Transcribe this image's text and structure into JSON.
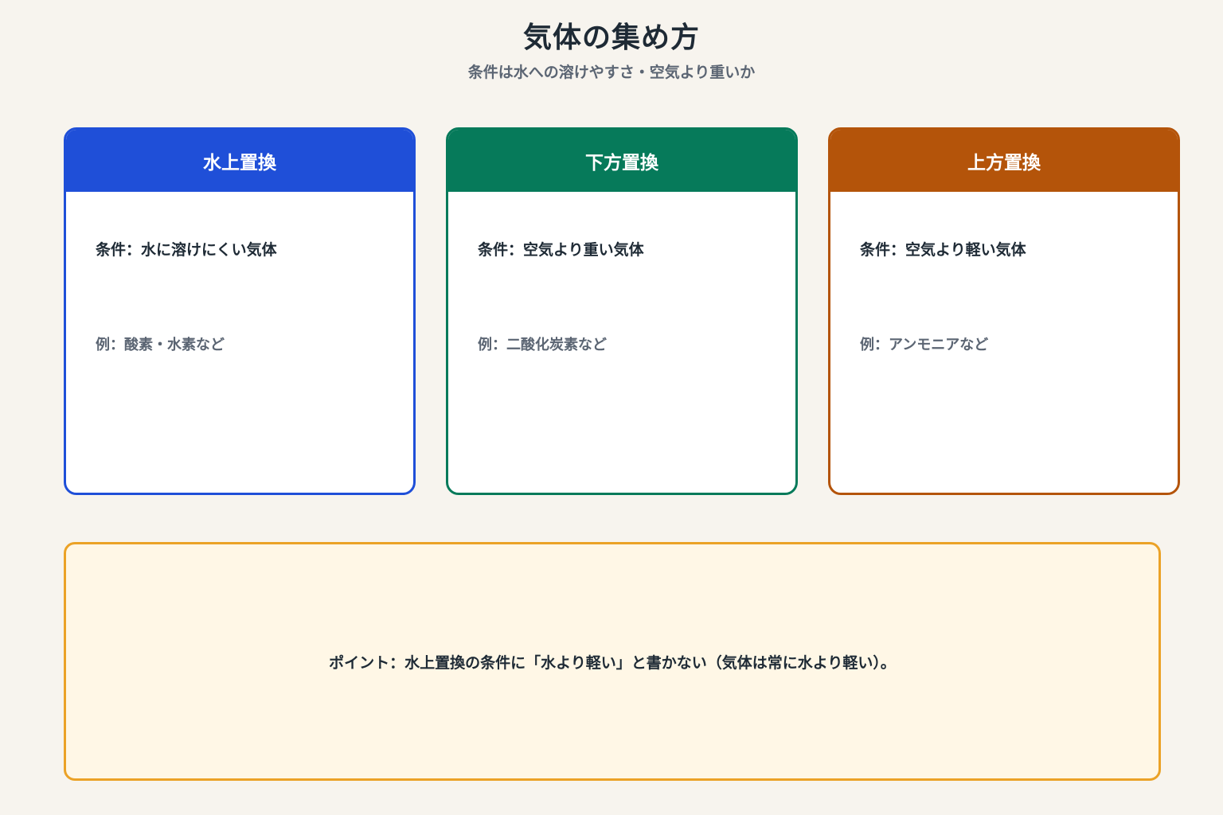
{
  "header": {
    "title": "気体の集め方",
    "subtitle": "条件は水への溶けやすさ・空気より重いか"
  },
  "methods": [
    {
      "name": "水上置換",
      "condition": "条件：水に溶けにくい気体",
      "example": "例：酸素・水素など",
      "color": "#1f4fd8"
    },
    {
      "name": "下方置換",
      "condition": "条件：空気より重い気体",
      "example": "例：二酸化炭素など",
      "color": "#067a5a"
    },
    {
      "name": "上方置換",
      "condition": "条件：空気より軽い気体",
      "example": "例：アンモニアなど",
      "color": "#b4540a"
    }
  ],
  "point": {
    "text": "ポイント：水上置換の条件に「水より軽い」と書かない（気体は常に水より軽い）。",
    "color": "#eba227"
  }
}
